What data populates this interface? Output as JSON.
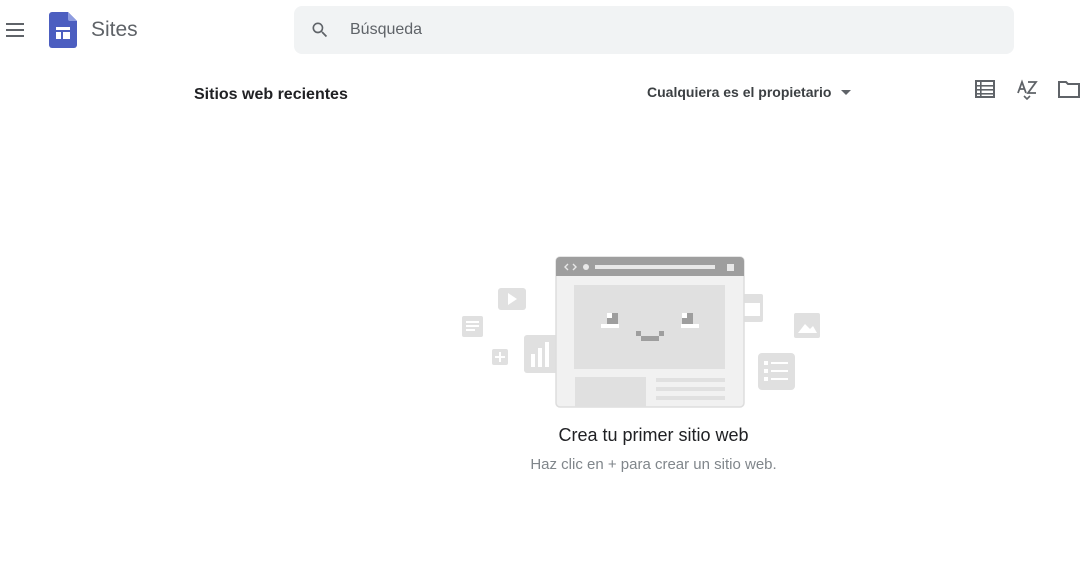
{
  "header": {
    "menu_icon": "hamburger-menu-icon",
    "logo_icon": "google-sites-logo-icon",
    "app_name": "Sites",
    "brand_color": "#4c5ec0",
    "search": {
      "placeholder": "Búsqueda",
      "value": "",
      "icon": "search-icon"
    }
  },
  "toolbar": {
    "section_title": "Sitios web recientes",
    "owner_filter": {
      "label": "Cualquiera es el propietario",
      "icon": "dropdown-arrow-icon"
    },
    "actions": [
      {
        "name": "list-view",
        "icon": "list-view-icon"
      },
      {
        "name": "sort",
        "icon": "sort-az-icon"
      },
      {
        "name": "folder",
        "icon": "folder-icon"
      }
    ]
  },
  "empty_state": {
    "illustration": "empty-sites-illustration",
    "title": "Crea tu primer sitio web",
    "subtitle": "Haz clic en + para crear un sitio web."
  }
}
